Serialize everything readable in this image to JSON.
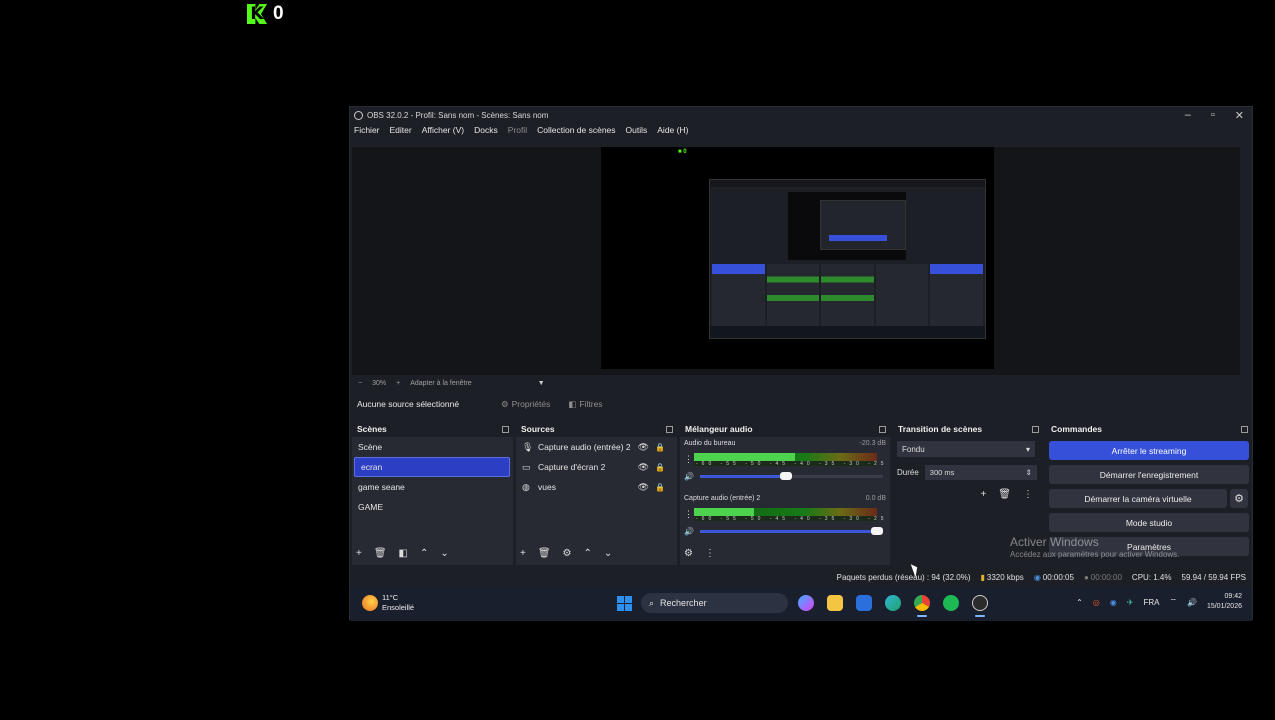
{
  "overlay": {
    "kick_count": "0"
  },
  "window": {
    "title": "OBS 32.0.2 - Profil: Sans nom - Scènes: Sans nom",
    "controls": [
      "–",
      "▫",
      "✕"
    ]
  },
  "menu": [
    "Fichier",
    "Editer",
    "Afficher (V)",
    "Docks",
    "Profil",
    "Collection de scènes",
    "Outils",
    "Aide (H)"
  ],
  "preview": {
    "mini_kick": "0"
  },
  "zoom": {
    "minus": "−",
    "value": "30%",
    "plus": "+",
    "fit": "Adapter à la fenêtre"
  },
  "source_toolbar": {
    "no_source": "Aucune source sélectionné",
    "properties": "Propriétés",
    "filters": "Filtres"
  },
  "docks": {
    "scenes": {
      "title": "Scènes",
      "items": [
        "Scène",
        "ecran",
        "game seane",
        "GAME"
      ],
      "selected_index": 1
    },
    "sources": {
      "title": "Sources",
      "items": [
        {
          "label": "Capture audio (entrée) 2",
          "icon": "microphone-icon"
        },
        {
          "label": "Capture d'écran 2",
          "icon": "monitor-icon"
        },
        {
          "label": "vues",
          "icon": "browser-icon"
        }
      ]
    },
    "mixer": {
      "title": "Mélangeur audio",
      "channels": [
        {
          "name": "Audio du bureau",
          "db": "-20.3 dB",
          "level": 0.55,
          "volume": 0.47
        },
        {
          "name": "Capture audio (entrée) 2",
          "db": "0.0 dB",
          "level": 0.33,
          "volume": 0.97
        }
      ],
      "scale": "-60 -55 -50 -45 -40 -35 -30 -25 -20 -15 -10 -5 0"
    },
    "transitions": {
      "title": "Transition de scènes",
      "type": "Fondu",
      "duration_label": "Durée",
      "duration_value": "300 ms"
    },
    "commands": {
      "title": "Commandes",
      "stop_streaming": "Arrêter le streaming",
      "start_recording": "Démarrer l'enregistrement",
      "start_virtualcam": "Démarrer la caméra virtuelle",
      "studio_mode": "Mode studio",
      "settings": "Paramètres"
    }
  },
  "watermark": {
    "line1": "Activer Windows",
    "line2": "Accédez aux paramètres pour activer Windows."
  },
  "status": {
    "dropped": "Paquets perdus (réseau) : 94 (32.0%)",
    "bitrate": "3320 kbps",
    "stream_time": "00:00:05",
    "rec_time": "00:00:00",
    "cpu": "CPU: 1.4%",
    "fps": "59.94 / 59.94 FPS"
  },
  "taskbar": {
    "temperature": "11°C",
    "weather": "Ensoleillé",
    "search_placeholder": "Rechercher",
    "language": "FRA",
    "time": "09:42",
    "date": "15/01/2026"
  },
  "colors": {
    "accent": "#3650d9",
    "kick_green": "#53fc18",
    "window_bg": "#1d1f26",
    "panel_bg": "#272a33"
  }
}
